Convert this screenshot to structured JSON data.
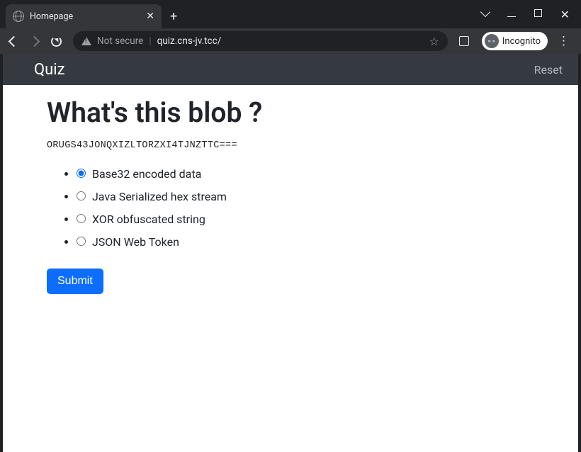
{
  "browser": {
    "tab_title": "Homepage",
    "not_secure_label": "Not secure",
    "url": "quiz.cns-jv.tcc/",
    "incognito_label": "Incognito"
  },
  "navbar": {
    "brand": "Quiz",
    "reset": "Reset"
  },
  "quiz": {
    "heading": "What's this blob ?",
    "blob": "ORUGS43JONQXIZLTORZXI4TJNZTTC===",
    "options": [
      "Base32 encoded data",
      "Java Serialized hex stream",
      "XOR obfuscated string",
      "JSON Web Token"
    ],
    "selected_index": 0,
    "submit_label": "Submit"
  }
}
